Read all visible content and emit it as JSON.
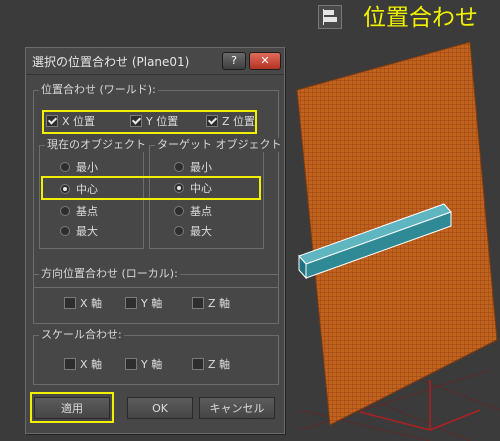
{
  "header": {
    "title": "位置合わせ",
    "accent_color": "#f2f200"
  },
  "dialog": {
    "title": "選択の位置合わせ (Plane01)",
    "titlebar": {
      "help_label": "?",
      "close_label": "✕"
    },
    "world_group": {
      "label": "位置合わせ (ワールド):",
      "checks": [
        {
          "label": "X 位置",
          "checked": true
        },
        {
          "label": "Y 位置",
          "checked": true
        },
        {
          "label": "Z 位置",
          "checked": true
        }
      ]
    },
    "current_object": {
      "label": "現在のオブジェクト",
      "options": [
        "最小",
        "中心",
        "基点",
        "最大"
      ],
      "selected": "中心"
    },
    "target_object": {
      "label": "ターゲット オブジェクト",
      "options": [
        "最小",
        "中心",
        "基点",
        "最大"
      ],
      "selected": "中心"
    },
    "orientation_group": {
      "label": "方向位置合わせ (ローカル):",
      "checks": [
        {
          "label": "X 軸",
          "checked": false
        },
        {
          "label": "Y 軸",
          "checked": false
        },
        {
          "label": "Z 軸",
          "checked": false
        }
      ]
    },
    "scale_group": {
      "label": "スケール合わせ:",
      "checks": [
        {
          "label": "X 軸",
          "checked": false
        },
        {
          "label": "Y 軸",
          "checked": false
        },
        {
          "label": "Z 軸",
          "checked": false
        }
      ]
    },
    "buttons": {
      "apply": "適用",
      "ok": "OK",
      "cancel": "キャンセル"
    }
  },
  "colors": {
    "highlight": "#f0f000",
    "plane": "#c2621f",
    "box": "#3e97a3",
    "close": "#c0392b"
  }
}
